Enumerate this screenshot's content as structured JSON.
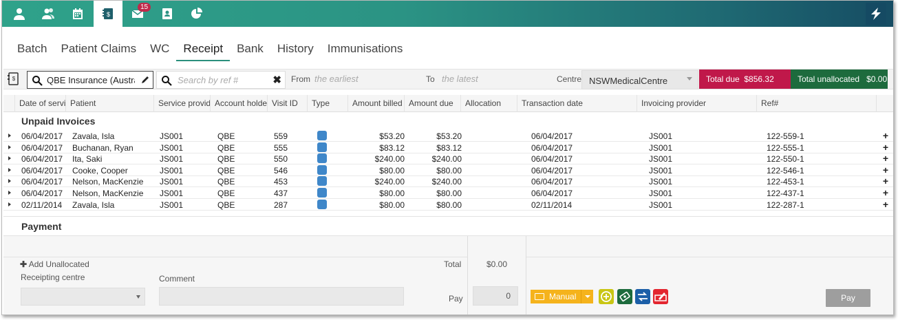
{
  "topnav": {
    "items": [
      {
        "name": "person-icon",
        "active": false
      },
      {
        "name": "patients-icon",
        "active": false
      },
      {
        "name": "calendar-icon",
        "active": false
      },
      {
        "name": "billing-icon",
        "active": true
      },
      {
        "name": "mail-icon",
        "active": false,
        "badge": "15"
      },
      {
        "name": "contacts-icon",
        "active": false
      },
      {
        "name": "reports-pie-icon",
        "active": false
      }
    ],
    "brand_icon": "app-logo-icon"
  },
  "tabs": [
    "Batch",
    "Patient Claims",
    "WC",
    "Receipt",
    "Bank",
    "History",
    "Immunisations"
  ],
  "active_tab": "Receipt",
  "filters": {
    "insurer_value": "QBE Insurance (Australia)",
    "ref_placeholder": "Search by ref #",
    "from_label": "From",
    "from_placeholder": "the earliest",
    "to_label": "To",
    "to_placeholder": "the latest",
    "centre_label": "Centre",
    "centre_value": "NSWMedicalCentre",
    "total_due_label": "Total due",
    "total_due_value": "$856.32",
    "total_unallocated_label": "Total unallocated",
    "total_unallocated_value": "$0.00"
  },
  "columns": [
    "Date of service",
    "Patient",
    "Service provider",
    "Account holder",
    "Visit ID",
    "Type",
    "Amount billed",
    "Amount due",
    "Allocation",
    "Transaction date",
    "Invoicing provider",
    "Ref#"
  ],
  "unpaid_title": "Unpaid Invoices",
  "rows": [
    {
      "date": "06/04/2017",
      "patient": "Zavala, Isla",
      "provider": "JS001",
      "holder": "QBE",
      "visit": "559",
      "billed": "$53.20",
      "due": "$53.20",
      "trans": "06/04/2017",
      "invprov": "JS001",
      "ref": "122-559-1"
    },
    {
      "date": "06/04/2017",
      "patient": "Buchanan, Ryan",
      "provider": "JS001",
      "holder": "QBE",
      "visit": "555",
      "billed": "$83.12",
      "due": "$83.12",
      "trans": "06/04/2017",
      "invprov": "JS001",
      "ref": "122-555-1"
    },
    {
      "date": "06/04/2017",
      "patient": "Ita, Saki",
      "provider": "JS001",
      "holder": "QBE",
      "visit": "550",
      "billed": "$240.00",
      "due": "$240.00",
      "trans": "06/04/2017",
      "invprov": "JS001",
      "ref": "122-550-1"
    },
    {
      "date": "06/04/2017",
      "patient": "Cooke, Cooper",
      "provider": "JS001",
      "holder": "QBE",
      "visit": "546",
      "billed": "$80.00",
      "due": "$80.00",
      "trans": "06/04/2017",
      "invprov": "JS001",
      "ref": "122-546-1"
    },
    {
      "date": "06/04/2017",
      "patient": "Nelson, MacKenzie",
      "provider": "JS001",
      "holder": "QBE",
      "visit": "453",
      "billed": "$240.00",
      "due": "$240.00",
      "trans": "06/04/2017",
      "invprov": "JS001",
      "ref": "122-453-1"
    },
    {
      "date": "06/04/2017",
      "patient": "Nelson, MacKenzie",
      "provider": "JS001",
      "holder": "QBE",
      "visit": "437",
      "billed": "$80.00",
      "due": "$80.00",
      "trans": "06/04/2017",
      "invprov": "JS001",
      "ref": "122-437-1"
    },
    {
      "date": "02/11/2014",
      "patient": "Zavala, Isla",
      "provider": "JS001",
      "holder": "QBE",
      "visit": "287",
      "billed": "$80.00",
      "due": "$80.00",
      "trans": "02/11/2014",
      "invprov": "JS001",
      "ref": "122-287-1"
    }
  ],
  "payment": {
    "title": "Payment",
    "add_unallocated": "Add Unallocated",
    "receipting_centre_label": "Receipting centre",
    "comment_label": "Comment",
    "total_label": "Total",
    "total_value": "$0.00",
    "pay_label": "Pay",
    "pay_value": "0",
    "method_label": "Manual",
    "pay_button": "Pay"
  },
  "colors": {
    "accent": "#2a8f7c",
    "total_due": "#c0184a",
    "total_unallocated": "#1d6b3d",
    "manual": "#f5b31c"
  }
}
